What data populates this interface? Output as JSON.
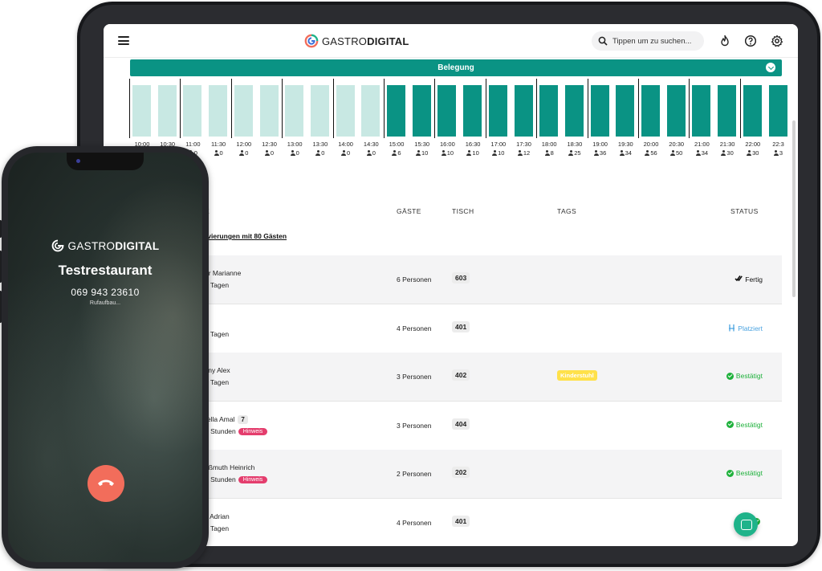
{
  "app": {
    "brand_light": "GASTRO",
    "brand_bold": "DIGITAL",
    "accent": "#0a9384"
  },
  "topbar": {
    "search_placeholder": "Tippen um zu suchen..."
  },
  "occupancy": {
    "title": "Belegung",
    "slots": [
      {
        "time": "10:00",
        "count": "0",
        "full": false
      },
      {
        "time": "10:30",
        "count": "0",
        "full": false
      },
      {
        "time": "11:00",
        "count": "0",
        "full": false
      },
      {
        "time": "11:30",
        "count": "0",
        "full": false
      },
      {
        "time": "12:00",
        "count": "0",
        "full": false
      },
      {
        "time": "12:30",
        "count": "0",
        "full": false
      },
      {
        "time": "13:00",
        "count": "0",
        "full": false
      },
      {
        "time": "13:30",
        "count": "0",
        "full": false
      },
      {
        "time": "14:00",
        "count": "0",
        "full": false
      },
      {
        "time": "14:30",
        "count": "0",
        "full": false
      },
      {
        "time": "15:00",
        "count": "6",
        "full": true
      },
      {
        "time": "15:30",
        "count": "10",
        "full": true
      },
      {
        "time": "16:00",
        "count": "10",
        "full": true
      },
      {
        "time": "16:30",
        "count": "10",
        "full": true
      },
      {
        "time": "17:00",
        "count": "10",
        "full": true
      },
      {
        "time": "17:30",
        "count": "12",
        "full": true
      },
      {
        "time": "18:00",
        "count": "8",
        "full": true
      },
      {
        "time": "18:30",
        "count": "25",
        "full": true
      },
      {
        "time": "19:00",
        "count": "36",
        "full": true
      },
      {
        "time": "19:30",
        "count": "34",
        "full": true
      },
      {
        "time": "20:00",
        "count": "56",
        "full": true
      },
      {
        "time": "20:30",
        "count": "50",
        "full": true
      },
      {
        "time": "21:00",
        "count": "34",
        "full": true
      },
      {
        "time": "21:30",
        "count": "30",
        "full": true
      },
      {
        "time": "22:00",
        "count": "30",
        "full": true
      },
      {
        "time": "22:3",
        "count": "3",
        "full": true
      }
    ]
  },
  "table": {
    "headers": {
      "name": "E",
      "guests": "GÄSTE",
      "table": "TISCH",
      "tags": "TAGS",
      "status": "STATUS"
    },
    "summary_prefix": "rvierungen mit ",
    "summary_bold": "80 Gästen",
    "rows": [
      {
        "name": "er Marianne",
        "since": "4 Tagen",
        "guests": "6 Personen",
        "table": "603",
        "tag": "",
        "status": "Fertig",
        "status_kind": "done",
        "hint": "",
        "badge": ""
      },
      {
        "name": "",
        "since": "4 Tagen",
        "guests": "4 Personen",
        "table": "401",
        "tag": "",
        "status": "Platziert",
        "status_kind": "seated",
        "hint": "",
        "badge": ""
      },
      {
        "name": "sny Alex",
        "since": "4 Tagen",
        "guests": "3 Personen",
        "table": "402",
        "tag": "Kinderstuhl",
        "status": "Bestätigt",
        "status_kind": "confirmed",
        "hint": "",
        "badge": ""
      },
      {
        "name": "rella Amal",
        "since": "8 Stunden",
        "guests": "3 Personen",
        "table": "404",
        "tag": "",
        "status": "Bestätigt",
        "status_kind": "confirmed",
        "hint": "Hinweis",
        "badge": "7"
      },
      {
        "name": "aßmuth Heinrich",
        "since": "8 Stunden",
        "guests": "2 Personen",
        "table": "202",
        "tag": "",
        "status": "Bestätigt",
        "status_kind": "confirmed",
        "hint": "Hinweis",
        "badge": ""
      },
      {
        "name": "k Adrian",
        "since": "4 Tagen",
        "guests": "4 Personen",
        "table": "401",
        "tag": "",
        "status": "",
        "status_kind": "confirmed",
        "hint": "",
        "badge": ""
      }
    ]
  },
  "phone": {
    "brand_light": "GASTRO",
    "brand_bold": "DIGITAL",
    "caller": "Testrestaurant",
    "number": "069 943 23610",
    "state": "Rufaufbau..."
  }
}
